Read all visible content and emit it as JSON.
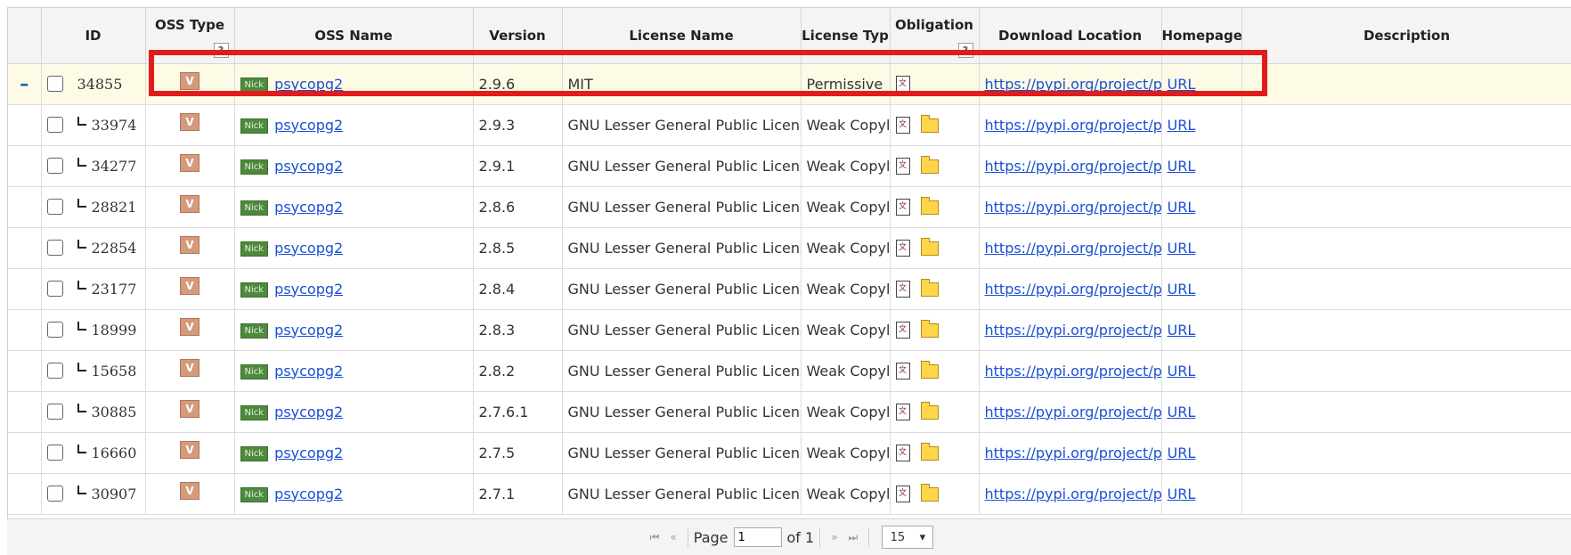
{
  "headers": {
    "id": "ID",
    "oss_type": "OSS Type",
    "oss_type_help": "?",
    "oss_name": "OSS Name",
    "version": "Version",
    "license_name": "License Name",
    "license_type": "License Typ",
    "obligation": "Obligation",
    "obligation_help": "?",
    "download_location": "Download Location",
    "homepage": "Homepage",
    "description": "Description"
  },
  "rows": [
    {
      "id": "34855",
      "oss_type_icon": "V",
      "nick": "Nick",
      "oss_name": "psycopg2",
      "version": "2.9.6",
      "license_name": "MIT",
      "license_type": "Permissive",
      "download": "https://pypi.org/project/ps",
      "homepage": "URL",
      "description": ""
    },
    {
      "id": "33974",
      "oss_type_icon": "V",
      "nick": "Nick",
      "oss_name": "psycopg2",
      "version": "2.9.3",
      "license_name": "GNU Lesser General Public License",
      "license_type": "Weak Copyle",
      "download": "https://pypi.org/project/ps",
      "homepage": "URL",
      "description": ""
    },
    {
      "id": "34277",
      "oss_type_icon": "V",
      "nick": "Nick",
      "oss_name": "psycopg2",
      "version": "2.9.1",
      "license_name": "GNU Lesser General Public License",
      "license_type": "Weak Copyle",
      "download": "https://pypi.org/project/ps",
      "homepage": "URL",
      "description": ""
    },
    {
      "id": "28821",
      "oss_type_icon": "V",
      "nick": "Nick",
      "oss_name": "psycopg2",
      "version": "2.8.6",
      "license_name": "GNU Lesser General Public License",
      "license_type": "Weak Copyle",
      "download": "https://pypi.org/project/ps",
      "homepage": "URL",
      "description": ""
    },
    {
      "id": "22854",
      "oss_type_icon": "V",
      "nick": "Nick",
      "oss_name": "psycopg2",
      "version": "2.8.5",
      "license_name": "GNU Lesser General Public License",
      "license_type": "Weak Copyle",
      "download": "https://pypi.org/project/ps",
      "homepage": "URL",
      "description": ""
    },
    {
      "id": "23177",
      "oss_type_icon": "V",
      "nick": "Nick",
      "oss_name": "psycopg2",
      "version": "2.8.4",
      "license_name": "GNU Lesser General Public License",
      "license_type": "Weak Copyle",
      "download": "https://pypi.org/project/ps",
      "homepage": "URL",
      "description": ""
    },
    {
      "id": "18999",
      "oss_type_icon": "V",
      "nick": "Nick",
      "oss_name": "psycopg2",
      "version": "2.8.3",
      "license_name": "GNU Lesser General Public License",
      "license_type": "Weak Copyle",
      "download": "https://pypi.org/project/ps",
      "homepage": "URL",
      "description": ""
    },
    {
      "id": "15658",
      "oss_type_icon": "V",
      "nick": "Nick",
      "oss_name": "psycopg2",
      "version": "2.8.2",
      "license_name": "GNU Lesser General Public License",
      "license_type": "Weak Copyle",
      "download": "https://pypi.org/project/ps",
      "homepage": "URL",
      "description": ""
    },
    {
      "id": "30885",
      "oss_type_icon": "V",
      "nick": "Nick",
      "oss_name": "psycopg2",
      "version": "2.7.6.1",
      "license_name": "GNU Lesser General Public License",
      "license_type": "Weak Copyle",
      "download": "https://pypi.org/project/ps",
      "homepage": "URL",
      "description": ""
    },
    {
      "id": "16660",
      "oss_type_icon": "V",
      "nick": "Nick",
      "oss_name": "psycopg2",
      "version": "2.7.5",
      "license_name": "GNU Lesser General Public License",
      "license_type": "Weak Copyle",
      "download": "https://pypi.org/project/ps",
      "homepage": "URL",
      "description": ""
    },
    {
      "id": "30907",
      "oss_type_icon": "V",
      "nick": "Nick",
      "oss_name": "psycopg2",
      "version": "2.7.1",
      "license_name": "GNU Lesser General Public License",
      "license_type": "Weak Copyle",
      "download": "https://pypi.org/project/ps",
      "homepage": "URL",
      "description": ""
    }
  ],
  "pager": {
    "page_label": "Page",
    "page_value": "1",
    "of_label": "of 1",
    "page_size": "15",
    "first": "⏮",
    "prev": "«",
    "next": "»",
    "last": "⏭"
  },
  "colors": {
    "highlight": "#e21b1b",
    "link": "#1a4fd6",
    "selected_row": "#fdfbe6"
  }
}
